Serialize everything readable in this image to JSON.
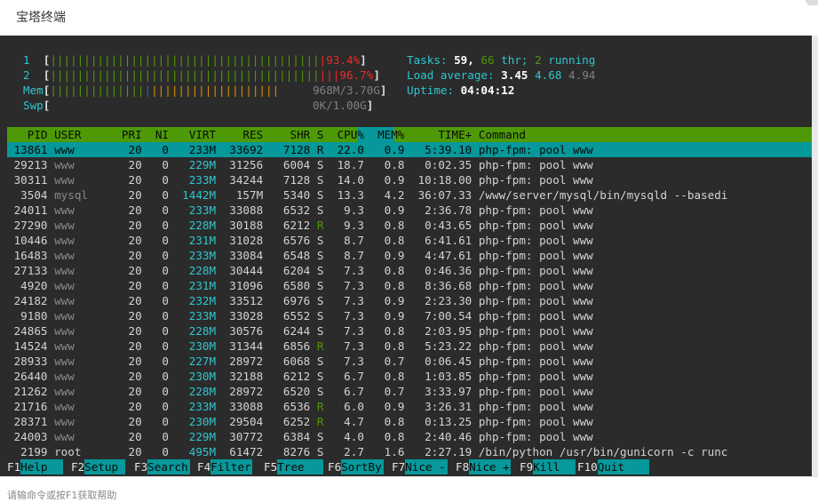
{
  "window": {
    "title": "宝塔终端",
    "footer_hint": "请输命令或按F1获取帮助"
  },
  "meters": {
    "cpu1": {
      "label": "1",
      "value": "93.4%"
    },
    "cpu2": {
      "label": "2",
      "value": "96.7%"
    },
    "mem": {
      "label": "Mem",
      "value": "968M/3.70G"
    },
    "swp": {
      "label": "Swp",
      "value": "0K/1.00G"
    }
  },
  "stats": {
    "tasks_label": "Tasks:",
    "tasks": "59,",
    "threads": "66",
    "thr_label": "thr;",
    "running": "2",
    "running_label": "running",
    "load_label": "Load average:",
    "load1": "3.45",
    "load5": "4.68",
    "load15": "4.94",
    "uptime_label": "Uptime:",
    "uptime": "04:04:12"
  },
  "table": {
    "headers": [
      "PID",
      "USER",
      "PRI",
      "NI",
      "VIRT",
      "RES",
      "SHR",
      "S",
      "CPU%",
      "MEM%",
      "TIME+",
      "Command"
    ],
    "rows": [
      {
        "pid": "13861",
        "user": "www",
        "pri": "20",
        "ni": "0",
        "virt": "233M",
        "res": "33692",
        "shr": "7128",
        "s": "R",
        "cpu": "22.0",
        "mem": "0.9",
        "time": "5:39.10",
        "cmd": "php-fpm: pool www"
      },
      {
        "pid": "29213",
        "user": "www",
        "pri": "20",
        "ni": "0",
        "virt": "229M",
        "res": "31256",
        "shr": "6004",
        "s": "S",
        "cpu": "18.7",
        "mem": "0.8",
        "time": "0:02.35",
        "cmd": "php-fpm: pool www"
      },
      {
        "pid": "30311",
        "user": "www",
        "pri": "20",
        "ni": "0",
        "virt": "233M",
        "res": "34244",
        "shr": "7128",
        "s": "S",
        "cpu": "14.0",
        "mem": "0.9",
        "time": "10:18.00",
        "cmd": "php-fpm: pool www"
      },
      {
        "pid": "3504",
        "user": "mysql",
        "pri": "20",
        "ni": "0",
        "virt": "1442M",
        "res": "157M",
        "shr": "5340",
        "s": "S",
        "cpu": "13.3",
        "mem": "4.2",
        "time": "36:07.33",
        "cmd": "/www/server/mysql/bin/mysqld --basedi"
      },
      {
        "pid": "24011",
        "user": "www",
        "pri": "20",
        "ni": "0",
        "virt": "233M",
        "res": "33088",
        "shr": "6532",
        "s": "S",
        "cpu": "9.3",
        "mem": "0.9",
        "time": "2:36.78",
        "cmd": "php-fpm: pool www"
      },
      {
        "pid": "27290",
        "user": "www",
        "pri": "20",
        "ni": "0",
        "virt": "228M",
        "res": "30188",
        "shr": "6212",
        "s": "R",
        "cpu": "9.3",
        "mem": "0.8",
        "time": "0:43.65",
        "cmd": "php-fpm: pool www"
      },
      {
        "pid": "10446",
        "user": "www",
        "pri": "20",
        "ni": "0",
        "virt": "231M",
        "res": "31028",
        "shr": "6576",
        "s": "S",
        "cpu": "8.7",
        "mem": "0.8",
        "time": "6:41.61",
        "cmd": "php-fpm: pool www"
      },
      {
        "pid": "16483",
        "user": "www",
        "pri": "20",
        "ni": "0",
        "virt": "233M",
        "res": "33084",
        "shr": "6548",
        "s": "S",
        "cpu": "8.7",
        "mem": "0.9",
        "time": "4:47.61",
        "cmd": "php-fpm: pool www"
      },
      {
        "pid": "27133",
        "user": "www",
        "pri": "20",
        "ni": "0",
        "virt": "228M",
        "res": "30444",
        "shr": "6204",
        "s": "S",
        "cpu": "7.3",
        "mem": "0.8",
        "time": "0:46.36",
        "cmd": "php-fpm: pool www"
      },
      {
        "pid": "4920",
        "user": "www",
        "pri": "20",
        "ni": "0",
        "virt": "231M",
        "res": "31096",
        "shr": "6580",
        "s": "S",
        "cpu": "7.3",
        "mem": "0.8",
        "time": "8:36.68",
        "cmd": "php-fpm: pool www"
      },
      {
        "pid": "24182",
        "user": "www",
        "pri": "20",
        "ni": "0",
        "virt": "232M",
        "res": "33512",
        "shr": "6976",
        "s": "S",
        "cpu": "7.3",
        "mem": "0.9",
        "time": "2:23.30",
        "cmd": "php-fpm: pool www"
      },
      {
        "pid": "9180",
        "user": "www",
        "pri": "20",
        "ni": "0",
        "virt": "233M",
        "res": "33028",
        "shr": "6552",
        "s": "S",
        "cpu": "7.3",
        "mem": "0.9",
        "time": "7:00.54",
        "cmd": "php-fpm: pool www"
      },
      {
        "pid": "24865",
        "user": "www",
        "pri": "20",
        "ni": "0",
        "virt": "228M",
        "res": "30576",
        "shr": "6244",
        "s": "S",
        "cpu": "7.3",
        "mem": "0.8",
        "time": "2:03.95",
        "cmd": "php-fpm: pool www"
      },
      {
        "pid": "14524",
        "user": "www",
        "pri": "20",
        "ni": "0",
        "virt": "230M",
        "res": "31344",
        "shr": "6856",
        "s": "R",
        "cpu": "7.3",
        "mem": "0.8",
        "time": "5:23.22",
        "cmd": "php-fpm: pool www"
      },
      {
        "pid": "28933",
        "user": "www",
        "pri": "20",
        "ni": "0",
        "virt": "227M",
        "res": "28972",
        "shr": "6068",
        "s": "S",
        "cpu": "7.3",
        "mem": "0.7",
        "time": "0:06.45",
        "cmd": "php-fpm: pool www"
      },
      {
        "pid": "26440",
        "user": "www",
        "pri": "20",
        "ni": "0",
        "virt": "230M",
        "res": "32188",
        "shr": "6212",
        "s": "S",
        "cpu": "6.7",
        "mem": "0.8",
        "time": "1:03.85",
        "cmd": "php-fpm: pool www"
      },
      {
        "pid": "21262",
        "user": "www",
        "pri": "20",
        "ni": "0",
        "virt": "228M",
        "res": "28972",
        "shr": "6520",
        "s": "S",
        "cpu": "6.7",
        "mem": "0.7",
        "time": "3:33.97",
        "cmd": "php-fpm: pool www"
      },
      {
        "pid": "21716",
        "user": "www",
        "pri": "20",
        "ni": "0",
        "virt": "233M",
        "res": "33088",
        "shr": "6536",
        "s": "R",
        "cpu": "6.0",
        "mem": "0.9",
        "time": "3:26.31",
        "cmd": "php-fpm: pool www"
      },
      {
        "pid": "28371",
        "user": "www",
        "pri": "20",
        "ni": "0",
        "virt": "230M",
        "res": "29504",
        "shr": "6252",
        "s": "R",
        "cpu": "4.7",
        "mem": "0.8",
        "time": "0:13.25",
        "cmd": "php-fpm: pool www"
      },
      {
        "pid": "24003",
        "user": "www",
        "pri": "20",
        "ni": "0",
        "virt": "229M",
        "res": "30772",
        "shr": "6384",
        "s": "S",
        "cpu": "4.0",
        "mem": "0.8",
        "time": "2:40.46",
        "cmd": "php-fpm: pool www"
      },
      {
        "pid": "2199",
        "user": "root",
        "pri": "20",
        "ni": "0",
        "virt": "495M",
        "res": "61472",
        "shr": "8276",
        "s": "S",
        "cpu": "2.7",
        "mem": "1.6",
        "time": "2:27.19",
        "cmd": "/bin/python /usr/bin/gunicorn -c runc"
      }
    ]
  },
  "fkeys": [
    {
      "key": "F1",
      "label": "Help"
    },
    {
      "key": "F2",
      "label": "Setup"
    },
    {
      "key": "F3",
      "label": "Search"
    },
    {
      "key": "F4",
      "label": "Filter"
    },
    {
      "key": "F5",
      "label": "Tree"
    },
    {
      "key": "F6",
      "label": "SortBy"
    },
    {
      "key": "F7",
      "label": "Nice -"
    },
    {
      "key": "F8",
      "label": "Nice +"
    },
    {
      "key": "F9",
      "label": "Kill"
    },
    {
      "key": "F10",
      "label": "Quit"
    }
  ],
  "colors": {
    "header_bg": "#4e9a06",
    "select_bg": "#06989a",
    "terminal_bg": "#2b2b2b"
  }
}
